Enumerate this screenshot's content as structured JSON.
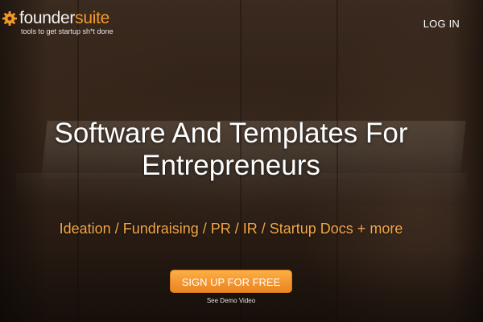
{
  "header": {
    "logo": {
      "word_part1": "founder",
      "word_part2": "suite",
      "tagline": "tools to get startup sh*t done",
      "icon": "gear-icon"
    },
    "login_label": "LOG IN"
  },
  "hero": {
    "headline_line1": "Software And Templates For",
    "headline_line2": "Entrepreneurs",
    "subheadline": "Ideation / Fundraising / PR / IR / Startup Docs + more",
    "cta_label": "SIGN UP FOR FREE",
    "demo_link": "See Demo Video"
  },
  "colors": {
    "brand_orange": "#f39a2b",
    "subheadline": "#f5a645",
    "cta_top": "#fbb046",
    "cta_bottom": "#ea8620"
  }
}
